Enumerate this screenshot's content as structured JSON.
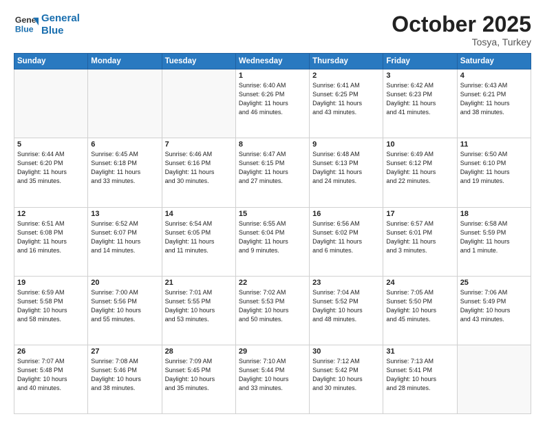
{
  "header": {
    "logo_line1": "General",
    "logo_line2": "Blue",
    "month": "October 2025",
    "location": "Tosya, Turkey"
  },
  "weekdays": [
    "Sunday",
    "Monday",
    "Tuesday",
    "Wednesday",
    "Thursday",
    "Friday",
    "Saturday"
  ],
  "weeks": [
    [
      {
        "day": "",
        "info": ""
      },
      {
        "day": "",
        "info": ""
      },
      {
        "day": "",
        "info": ""
      },
      {
        "day": "1",
        "info": "Sunrise: 6:40 AM\nSunset: 6:26 PM\nDaylight: 11 hours\nand 46 minutes."
      },
      {
        "day": "2",
        "info": "Sunrise: 6:41 AM\nSunset: 6:25 PM\nDaylight: 11 hours\nand 43 minutes."
      },
      {
        "day": "3",
        "info": "Sunrise: 6:42 AM\nSunset: 6:23 PM\nDaylight: 11 hours\nand 41 minutes."
      },
      {
        "day": "4",
        "info": "Sunrise: 6:43 AM\nSunset: 6:21 PM\nDaylight: 11 hours\nand 38 minutes."
      }
    ],
    [
      {
        "day": "5",
        "info": "Sunrise: 6:44 AM\nSunset: 6:20 PM\nDaylight: 11 hours\nand 35 minutes."
      },
      {
        "day": "6",
        "info": "Sunrise: 6:45 AM\nSunset: 6:18 PM\nDaylight: 11 hours\nand 33 minutes."
      },
      {
        "day": "7",
        "info": "Sunrise: 6:46 AM\nSunset: 6:16 PM\nDaylight: 11 hours\nand 30 minutes."
      },
      {
        "day": "8",
        "info": "Sunrise: 6:47 AM\nSunset: 6:15 PM\nDaylight: 11 hours\nand 27 minutes."
      },
      {
        "day": "9",
        "info": "Sunrise: 6:48 AM\nSunset: 6:13 PM\nDaylight: 11 hours\nand 24 minutes."
      },
      {
        "day": "10",
        "info": "Sunrise: 6:49 AM\nSunset: 6:12 PM\nDaylight: 11 hours\nand 22 minutes."
      },
      {
        "day": "11",
        "info": "Sunrise: 6:50 AM\nSunset: 6:10 PM\nDaylight: 11 hours\nand 19 minutes."
      }
    ],
    [
      {
        "day": "12",
        "info": "Sunrise: 6:51 AM\nSunset: 6:08 PM\nDaylight: 11 hours\nand 16 minutes."
      },
      {
        "day": "13",
        "info": "Sunrise: 6:52 AM\nSunset: 6:07 PM\nDaylight: 11 hours\nand 14 minutes."
      },
      {
        "day": "14",
        "info": "Sunrise: 6:54 AM\nSunset: 6:05 PM\nDaylight: 11 hours\nand 11 minutes."
      },
      {
        "day": "15",
        "info": "Sunrise: 6:55 AM\nSunset: 6:04 PM\nDaylight: 11 hours\nand 9 minutes."
      },
      {
        "day": "16",
        "info": "Sunrise: 6:56 AM\nSunset: 6:02 PM\nDaylight: 11 hours\nand 6 minutes."
      },
      {
        "day": "17",
        "info": "Sunrise: 6:57 AM\nSunset: 6:01 PM\nDaylight: 11 hours\nand 3 minutes."
      },
      {
        "day": "18",
        "info": "Sunrise: 6:58 AM\nSunset: 5:59 PM\nDaylight: 11 hours\nand 1 minute."
      }
    ],
    [
      {
        "day": "19",
        "info": "Sunrise: 6:59 AM\nSunset: 5:58 PM\nDaylight: 10 hours\nand 58 minutes."
      },
      {
        "day": "20",
        "info": "Sunrise: 7:00 AM\nSunset: 5:56 PM\nDaylight: 10 hours\nand 55 minutes."
      },
      {
        "day": "21",
        "info": "Sunrise: 7:01 AM\nSunset: 5:55 PM\nDaylight: 10 hours\nand 53 minutes."
      },
      {
        "day": "22",
        "info": "Sunrise: 7:02 AM\nSunset: 5:53 PM\nDaylight: 10 hours\nand 50 minutes."
      },
      {
        "day": "23",
        "info": "Sunrise: 7:04 AM\nSunset: 5:52 PM\nDaylight: 10 hours\nand 48 minutes."
      },
      {
        "day": "24",
        "info": "Sunrise: 7:05 AM\nSunset: 5:50 PM\nDaylight: 10 hours\nand 45 minutes."
      },
      {
        "day": "25",
        "info": "Sunrise: 7:06 AM\nSunset: 5:49 PM\nDaylight: 10 hours\nand 43 minutes."
      }
    ],
    [
      {
        "day": "26",
        "info": "Sunrise: 7:07 AM\nSunset: 5:48 PM\nDaylight: 10 hours\nand 40 minutes."
      },
      {
        "day": "27",
        "info": "Sunrise: 7:08 AM\nSunset: 5:46 PM\nDaylight: 10 hours\nand 38 minutes."
      },
      {
        "day": "28",
        "info": "Sunrise: 7:09 AM\nSunset: 5:45 PM\nDaylight: 10 hours\nand 35 minutes."
      },
      {
        "day": "29",
        "info": "Sunrise: 7:10 AM\nSunset: 5:44 PM\nDaylight: 10 hours\nand 33 minutes."
      },
      {
        "day": "30",
        "info": "Sunrise: 7:12 AM\nSunset: 5:42 PM\nDaylight: 10 hours\nand 30 minutes."
      },
      {
        "day": "31",
        "info": "Sunrise: 7:13 AM\nSunset: 5:41 PM\nDaylight: 10 hours\nand 28 minutes."
      },
      {
        "day": "",
        "info": ""
      }
    ]
  ]
}
